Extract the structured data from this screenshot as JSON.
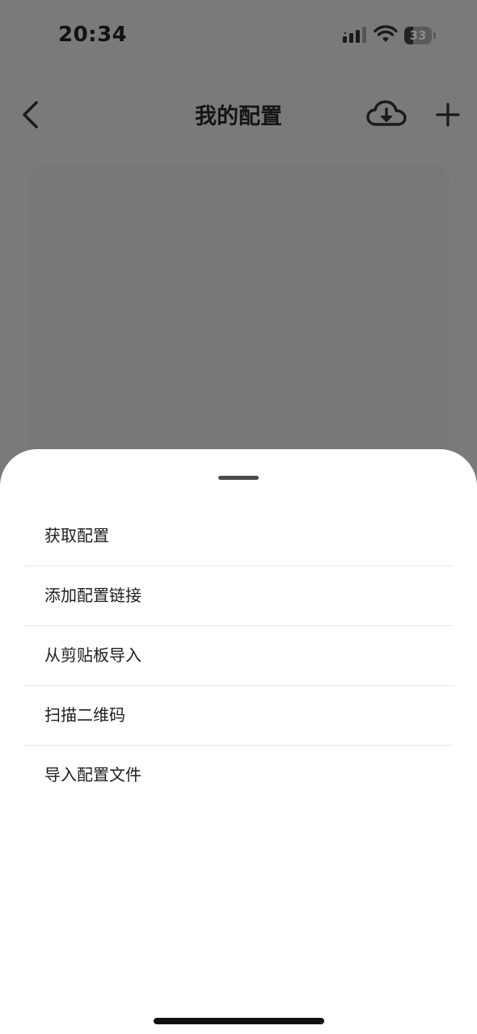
{
  "status_bar": {
    "time": "20:34",
    "battery_level": "33",
    "battery_fraction": 0.33,
    "icons": [
      "signal-icon",
      "wifi-icon",
      "battery-icon"
    ]
  },
  "nav": {
    "title": "我的配置",
    "back_icon": "chevron-left-icon",
    "cloud_icon": "cloud-download-icon",
    "add_icon": "plus-icon"
  },
  "sheet": {
    "items": [
      {
        "label": "获取配置"
      },
      {
        "label": "添加配置链接"
      },
      {
        "label": "从剪贴板导入"
      },
      {
        "label": "扫描二维码"
      },
      {
        "label": "导入配置文件"
      }
    ]
  },
  "colors": {
    "overlay": "#7a7a7a",
    "sheet_background": "#ffffff",
    "divider": "#e6e6e6",
    "text": "#1e1e1e"
  }
}
